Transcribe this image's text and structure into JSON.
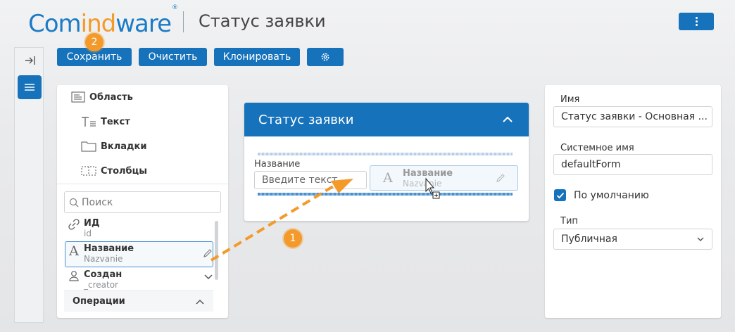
{
  "header": {
    "logo": {
      "part1": "Com",
      "part2": "ind",
      "part3": "ware",
      "mark": "®"
    },
    "title": "Статус заявки",
    "menu_icon": "kebab-menu-icon"
  },
  "toolbar": {
    "save_label": "Сохранить",
    "clear_label": "Очистить",
    "clone_label": "Клонировать",
    "settings_icon": "gear-icon",
    "callout_save": "2"
  },
  "palette": {
    "items": [
      {
        "label": "Область",
        "icon": "area-icon"
      },
      {
        "label": "Текст",
        "icon": "text-icon"
      },
      {
        "label": "Вкладки",
        "icon": "tabs-icon"
      },
      {
        "label": "Столбцы",
        "icon": "columns-icon"
      }
    ],
    "search_placeholder": "Поиск",
    "fields": [
      {
        "name": "ИД",
        "system": "id",
        "icon": "link-icon"
      },
      {
        "name": "Название",
        "system": "Nazvanie",
        "icon": "text-a-icon"
      },
      {
        "name": "Создан",
        "system": "_creator",
        "icon": "user-icon"
      }
    ],
    "operations_label": "Операции"
  },
  "form": {
    "title": "Статус заявки",
    "field_label": "Название",
    "field_placeholder": "Введите текст",
    "ghost_name": "Название",
    "ghost_system": "Nazvanie",
    "callout_drag": "1"
  },
  "properties": {
    "name_label": "Имя",
    "name_value": "Статус заявки - Основная ...",
    "system_label": "Системное имя",
    "system_value": "defaultForm",
    "default_label": "По умолчанию",
    "default_checked": true,
    "type_label": "Тип",
    "type_value": "Публичная"
  },
  "colors": {
    "accent": "#1572bb",
    "callout": "#f39a2a"
  }
}
